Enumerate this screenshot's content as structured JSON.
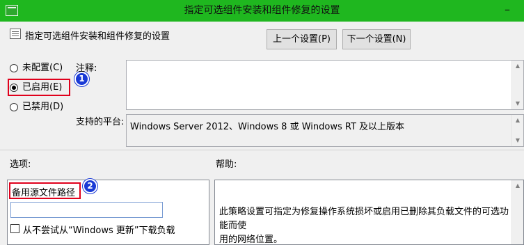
{
  "window": {
    "title": "指定可选组件安装和组件修复的设置",
    "minimize_glyph": "–"
  },
  "header": {
    "title": "指定可选组件安装和组件修复的设置",
    "icon": "policy-setting-icon"
  },
  "nav": {
    "prev_label": "上一个设置(P)",
    "next_label": "下一个设置(N)"
  },
  "state": {
    "options": [
      {
        "label": "未配置(C)",
        "checked": false
      },
      {
        "label": "已启用(E)",
        "checked": true
      },
      {
        "label": "已禁用(D)",
        "checked": false
      }
    ]
  },
  "comment": {
    "label": "注释:",
    "value": ""
  },
  "platform": {
    "label": "支持的平台:",
    "value": "Windows Server 2012、Windows 8 或 Windows RT 及以上版本"
  },
  "sections": {
    "options_label": "选项:",
    "help_label": "帮助:"
  },
  "options_panel": {
    "path_label": "备用源文件路径",
    "path_value": "",
    "no_wu_label": "从不尝试从“Windows 更新”下载负载",
    "no_wu_checked": false
  },
  "help": {
    "line1": "此策略设置可指定为修复操作系统损坏或启用已删除其负载文件的可选功能而使",
    "line2": "用的网络位置。"
  },
  "annotations": {
    "badge1": "1",
    "badge2": "2",
    "highlight_color": "#e0001c",
    "badge_color": "#1a3ad6"
  },
  "colors": {
    "titlebar": "#1fb71f"
  }
}
